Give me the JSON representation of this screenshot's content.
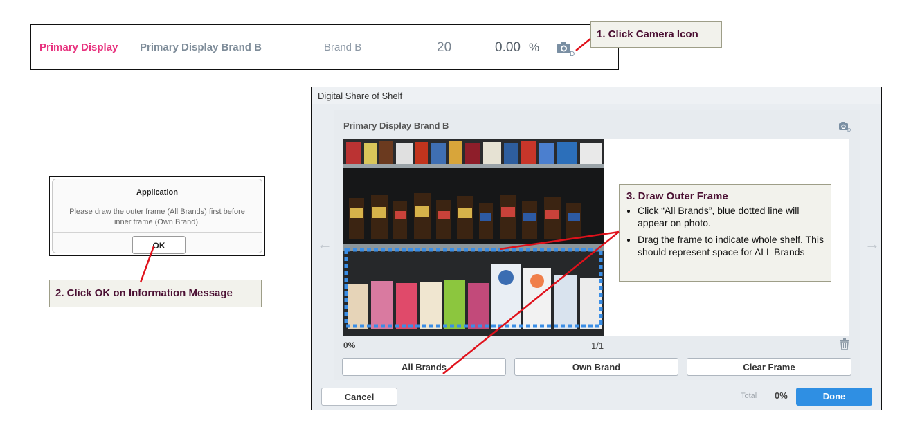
{
  "top_row": {
    "primary_label": "Primary Display",
    "brand_name": "Primary Display Brand B",
    "brand": "Brand B",
    "count": "20",
    "percent": "0.00",
    "percent_sign": "%",
    "camera_icon": "camera-icon"
  },
  "callouts": {
    "step1": "1. Click Camera Icon",
    "step2": "2. Click OK on Information Message",
    "step3_title": "3. Draw Outer Frame",
    "step3_bullets": [
      "Click “All Brands”, blue dotted line will appear on photo.",
      "Drag the frame to indicate whole shelf. This should represent space for ALL Brands"
    ]
  },
  "alert": {
    "title": "Application",
    "message": "Please draw the outer frame (All Brands) first before inner frame (Own Brand).",
    "ok_label": "OK"
  },
  "dss": {
    "window_title": "Digital Share of Shelf",
    "card_title": "Primary Display Brand B",
    "percent": "0%",
    "page": "1/1",
    "buttons": {
      "all_brands": "All Brands",
      "own_brand": "Own Brand",
      "clear_frame": "Clear Frame"
    },
    "footer": {
      "cancel": "Cancel",
      "total_label": "Total",
      "total_value": "0%",
      "done": "Done"
    }
  },
  "colors": {
    "accent_pink": "#e8327e",
    "done_blue": "#2f8fe3",
    "frame_blue": "#3a8ee6",
    "arrow_red": "#e0111b"
  }
}
